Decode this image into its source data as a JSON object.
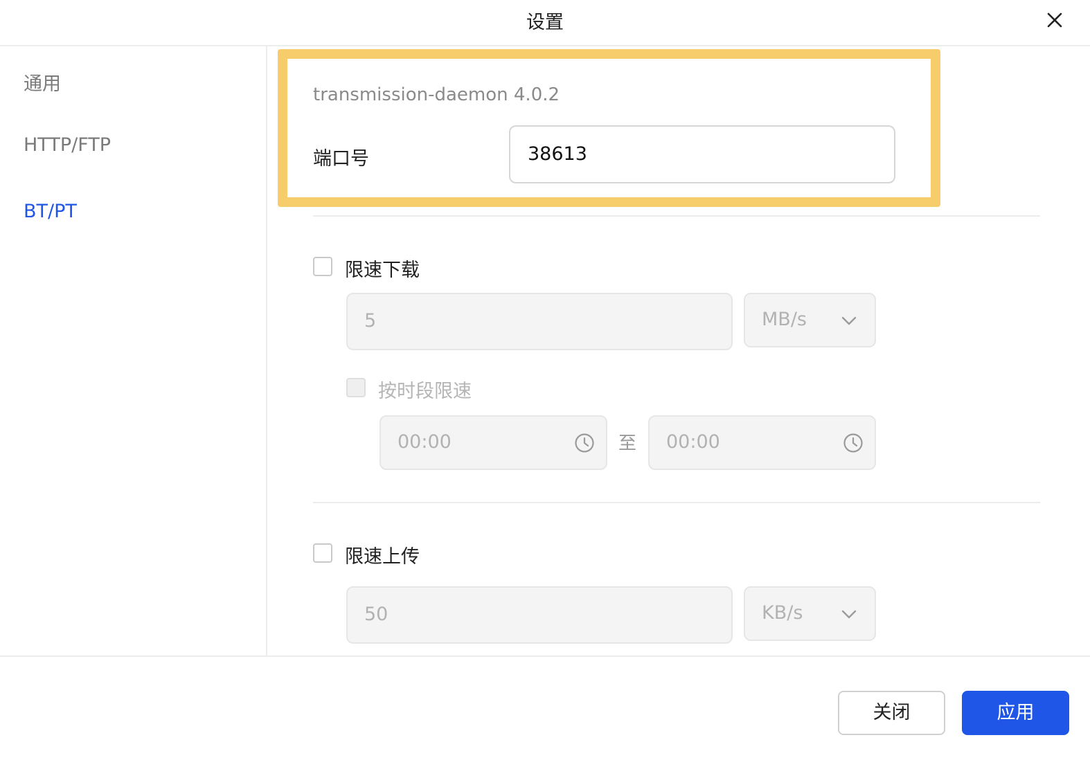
{
  "window": {
    "title": "设置"
  },
  "sidebar": {
    "items": [
      {
        "label": "通用",
        "active": false
      },
      {
        "label": "HTTP/FTP",
        "active": false
      },
      {
        "label": "BT/PT",
        "active": true
      }
    ]
  },
  "bt": {
    "version": "transmission-daemon 4.0.2",
    "port_label": "端口号",
    "port_value": "38613"
  },
  "download_limit": {
    "checkbox_label": "限速下载",
    "checked": false,
    "value": "5",
    "unit": "MB/s",
    "schedule": {
      "checkbox_label": "按时段限速",
      "checked": false,
      "start": "00:00",
      "to_label": "至",
      "end": "00:00"
    }
  },
  "upload_limit": {
    "checkbox_label": "限速上传",
    "checked": false,
    "value": "50",
    "unit": "KB/s"
  },
  "footer": {
    "close_label": "关闭",
    "apply_label": "应用"
  },
  "colors": {
    "accent": "#1f56e8",
    "highlight": "#f7cd6b"
  },
  "icons": {
    "close": "close-icon",
    "chevron": "chevron-down-icon",
    "clock": "clock-icon"
  }
}
